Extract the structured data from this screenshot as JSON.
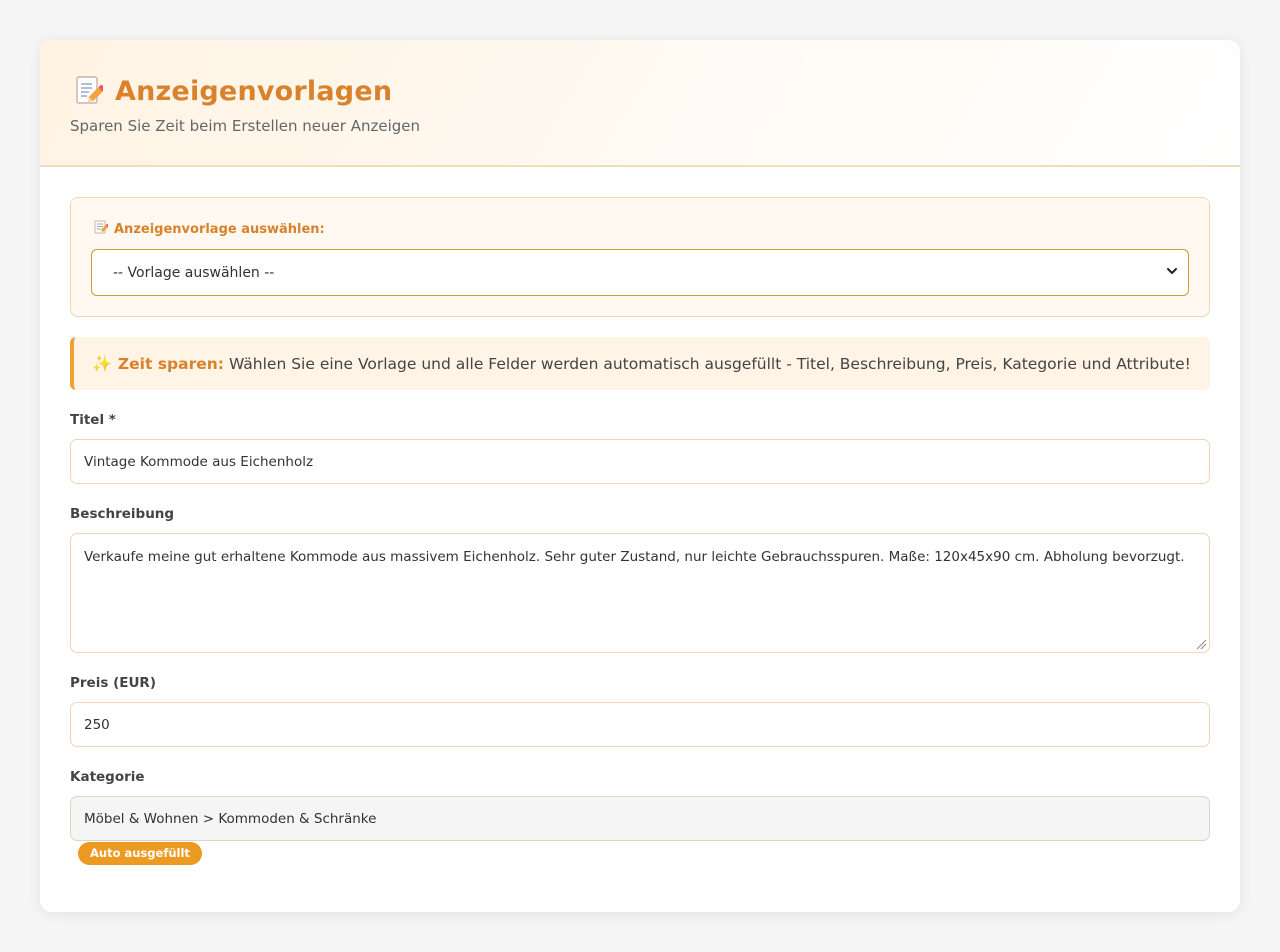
{
  "header": {
    "title": "Anzeigenvorlagen",
    "subtitle": "Sparen Sie Zeit beim Erstellen neuer Anzeigen",
    "icon": "document-pencil-icon"
  },
  "template_selector": {
    "label": "Anzeigenvorlage auswählen:",
    "selected": "-- Vorlage auswählen --"
  },
  "info": {
    "strong": "Zeit sparen:",
    "text": "Wählen Sie eine Vorlage und alle Felder werden automatisch ausgefüllt - Titel, Beschreibung, Preis, Kategorie und Attribute!",
    "icon": "sparkle-icon"
  },
  "form": {
    "title": {
      "label": "Titel *",
      "value": "Vintage Kommode aus Eichenholz"
    },
    "description": {
      "label": "Beschreibung",
      "value": "Verkaufe meine gut erhaltene Kommode aus massivem Eichenholz. Sehr guter Zustand, nur leichte Gebrauchsspuren. Maße: 120x45x90 cm. Abholung bevorzugt."
    },
    "price": {
      "label": "Preis (EUR)",
      "value": "250"
    },
    "category": {
      "label": "Kategorie",
      "value": "Möbel & Wohnen > Kommoden & Schränke",
      "badge": "Auto ausgefüllt"
    }
  },
  "colors": {
    "accent": "#d9822b",
    "badge": "#ec9a22",
    "info_border": "#f0a030"
  }
}
